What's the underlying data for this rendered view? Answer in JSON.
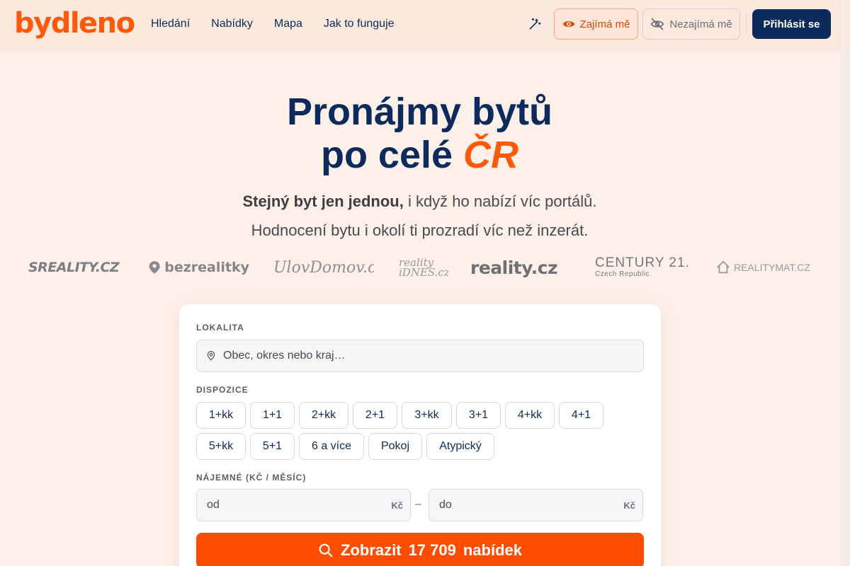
{
  "header": {
    "logo": "bydleno",
    "nav": [
      "Hledání",
      "Nabídky",
      "Mapa",
      "Jak to funguje"
    ],
    "like_label": "Zajímá mě",
    "dislike_label": "Nezajímá mě",
    "login_label": "Přihlásit se"
  },
  "hero": {
    "title_line1": "Pronájmy bytů",
    "title_line2_prefix": "po celé ",
    "title_line2_accent": "ČR",
    "subtitle_bold": "Stejný byt jen jednou,",
    "subtitle_rest": " i když ho nabízí víc portálů.",
    "subtitle2": "Hodnocení bytu i okolí ti prozradí víc než inzerát."
  },
  "portals": [
    "SREALITY.CZ",
    "bezrealitky",
    "UlovDomov.cz",
    "reality iDNES.cz",
    "reality.cz",
    "CENTURY 21.",
    "Czech Republic",
    "REALITYMAT.CZ"
  ],
  "search": {
    "location_label": "LOKALITA",
    "location_placeholder": "Obec, okres nebo kraj…",
    "disposition_label": "DISPOZICE",
    "dispositions": [
      "1+kk",
      "1+1",
      "2+kk",
      "2+1",
      "3+kk",
      "3+1",
      "4+kk",
      "4+1",
      "5+kk",
      "5+1",
      "6 a více",
      "Pokoj",
      "Atypický"
    ],
    "rent_label": "NÁJEMNÉ (KČ / MĚSÍC)",
    "rent_from_placeholder": "od",
    "rent_to_placeholder": "do",
    "currency": "Kč",
    "dash": "–",
    "submit_prefix": "Zobrazit",
    "submit_count": "17 709",
    "submit_suffix": "nabídek"
  },
  "colors": {
    "brand": "#ff5a0a",
    "navy": "#0d2a5c",
    "background": "#fdf0e8"
  }
}
